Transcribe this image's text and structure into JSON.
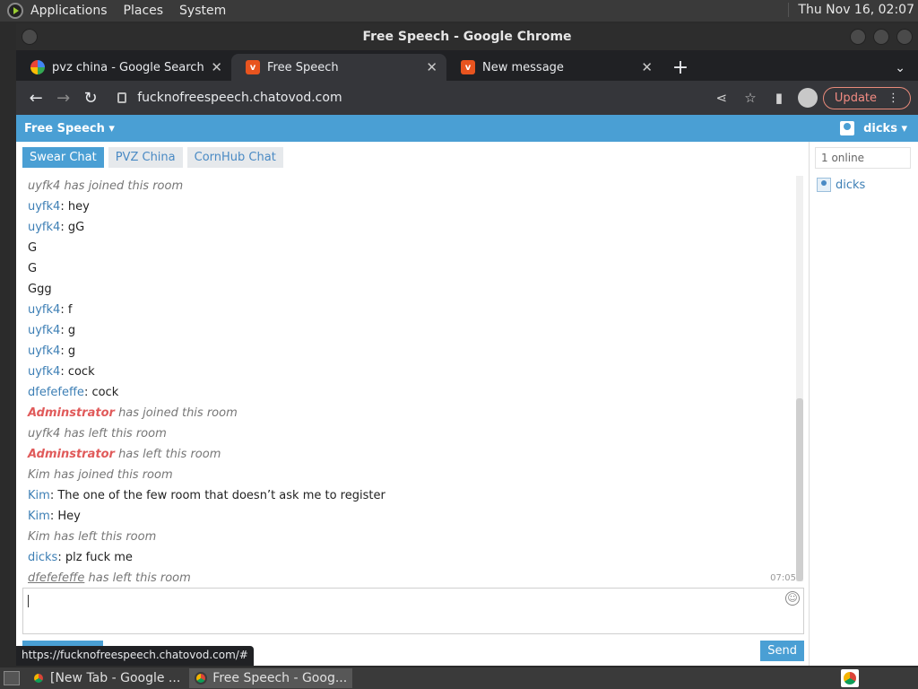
{
  "system_panel": {
    "menus": [
      "Applications",
      "Places",
      "System"
    ],
    "clock": "Thu Nov 16, 02:07"
  },
  "window": {
    "title": "Free Speech - Google Chrome",
    "tabs": [
      {
        "label": "pvz china - Google Search",
        "icon": "google-icon"
      },
      {
        "label": "Free Speech",
        "icon": "chatovod-icon"
      },
      {
        "label": "New message",
        "icon": "chatovod-icon"
      }
    ],
    "url": "fucknofreespeech.chatovod.com",
    "update_label": "Update"
  },
  "site": {
    "brand": "Free Speech",
    "user": "dicks",
    "room_tabs": [
      "Swear Chat",
      "PVZ China",
      "CornHub Chat"
    ],
    "online_count": "1 online",
    "online_users": [
      "dicks"
    ],
    "send_label": "Send",
    "status_url": "https://fucknofreespeech.chatovod.com/#",
    "last_time": "07:05"
  },
  "messages": [
    {
      "nick": "uyfk4",
      "text": "has joined this room",
      "type": "system"
    },
    {
      "nick": "uyfk4",
      "text": "hey",
      "type": "chat"
    },
    {
      "nick": "uyfk4",
      "text": "gG",
      "type": "chat"
    },
    {
      "nick": "",
      "text": "G",
      "type": "plain"
    },
    {
      "nick": "",
      "text": "G",
      "type": "plain"
    },
    {
      "nick": "",
      "text": "Ggg",
      "type": "plain"
    },
    {
      "nick": "uyfk4",
      "text": "f",
      "type": "chat"
    },
    {
      "nick": "uyfk4",
      "text": "g",
      "type": "chat"
    },
    {
      "nick": "uyfk4",
      "text": "g",
      "type": "chat"
    },
    {
      "nick": "uyfk4",
      "text": "cock",
      "type": "chat"
    },
    {
      "nick": "dfefefeffe",
      "text": "cock",
      "type": "chat"
    },
    {
      "nick": "Adminstrator",
      "text": "has joined this room",
      "type": "admin"
    },
    {
      "nick": "uyfk4",
      "text": "has left this room",
      "type": "system"
    },
    {
      "nick": "Adminstrator",
      "text": "has left this room",
      "type": "admin"
    },
    {
      "nick": "Kim",
      "text": "has joined this room",
      "type": "system"
    },
    {
      "nick": "Kim",
      "text": "The one of the few room that doesn’t ask me to register",
      "type": "chat"
    },
    {
      "nick": "Kim",
      "text": "Hey",
      "type": "chat"
    },
    {
      "nick": "Kim",
      "text": "has left this room",
      "type": "system"
    },
    {
      "nick": "dicks",
      "text": "plz fuck me",
      "type": "chat"
    },
    {
      "nick": "dfefefeffe",
      "text": "has left this room",
      "type": "system-link"
    }
  ],
  "taskbar": {
    "tasks": [
      "[New Tab - Google ...",
      "Free Speech - Goog..."
    ]
  }
}
